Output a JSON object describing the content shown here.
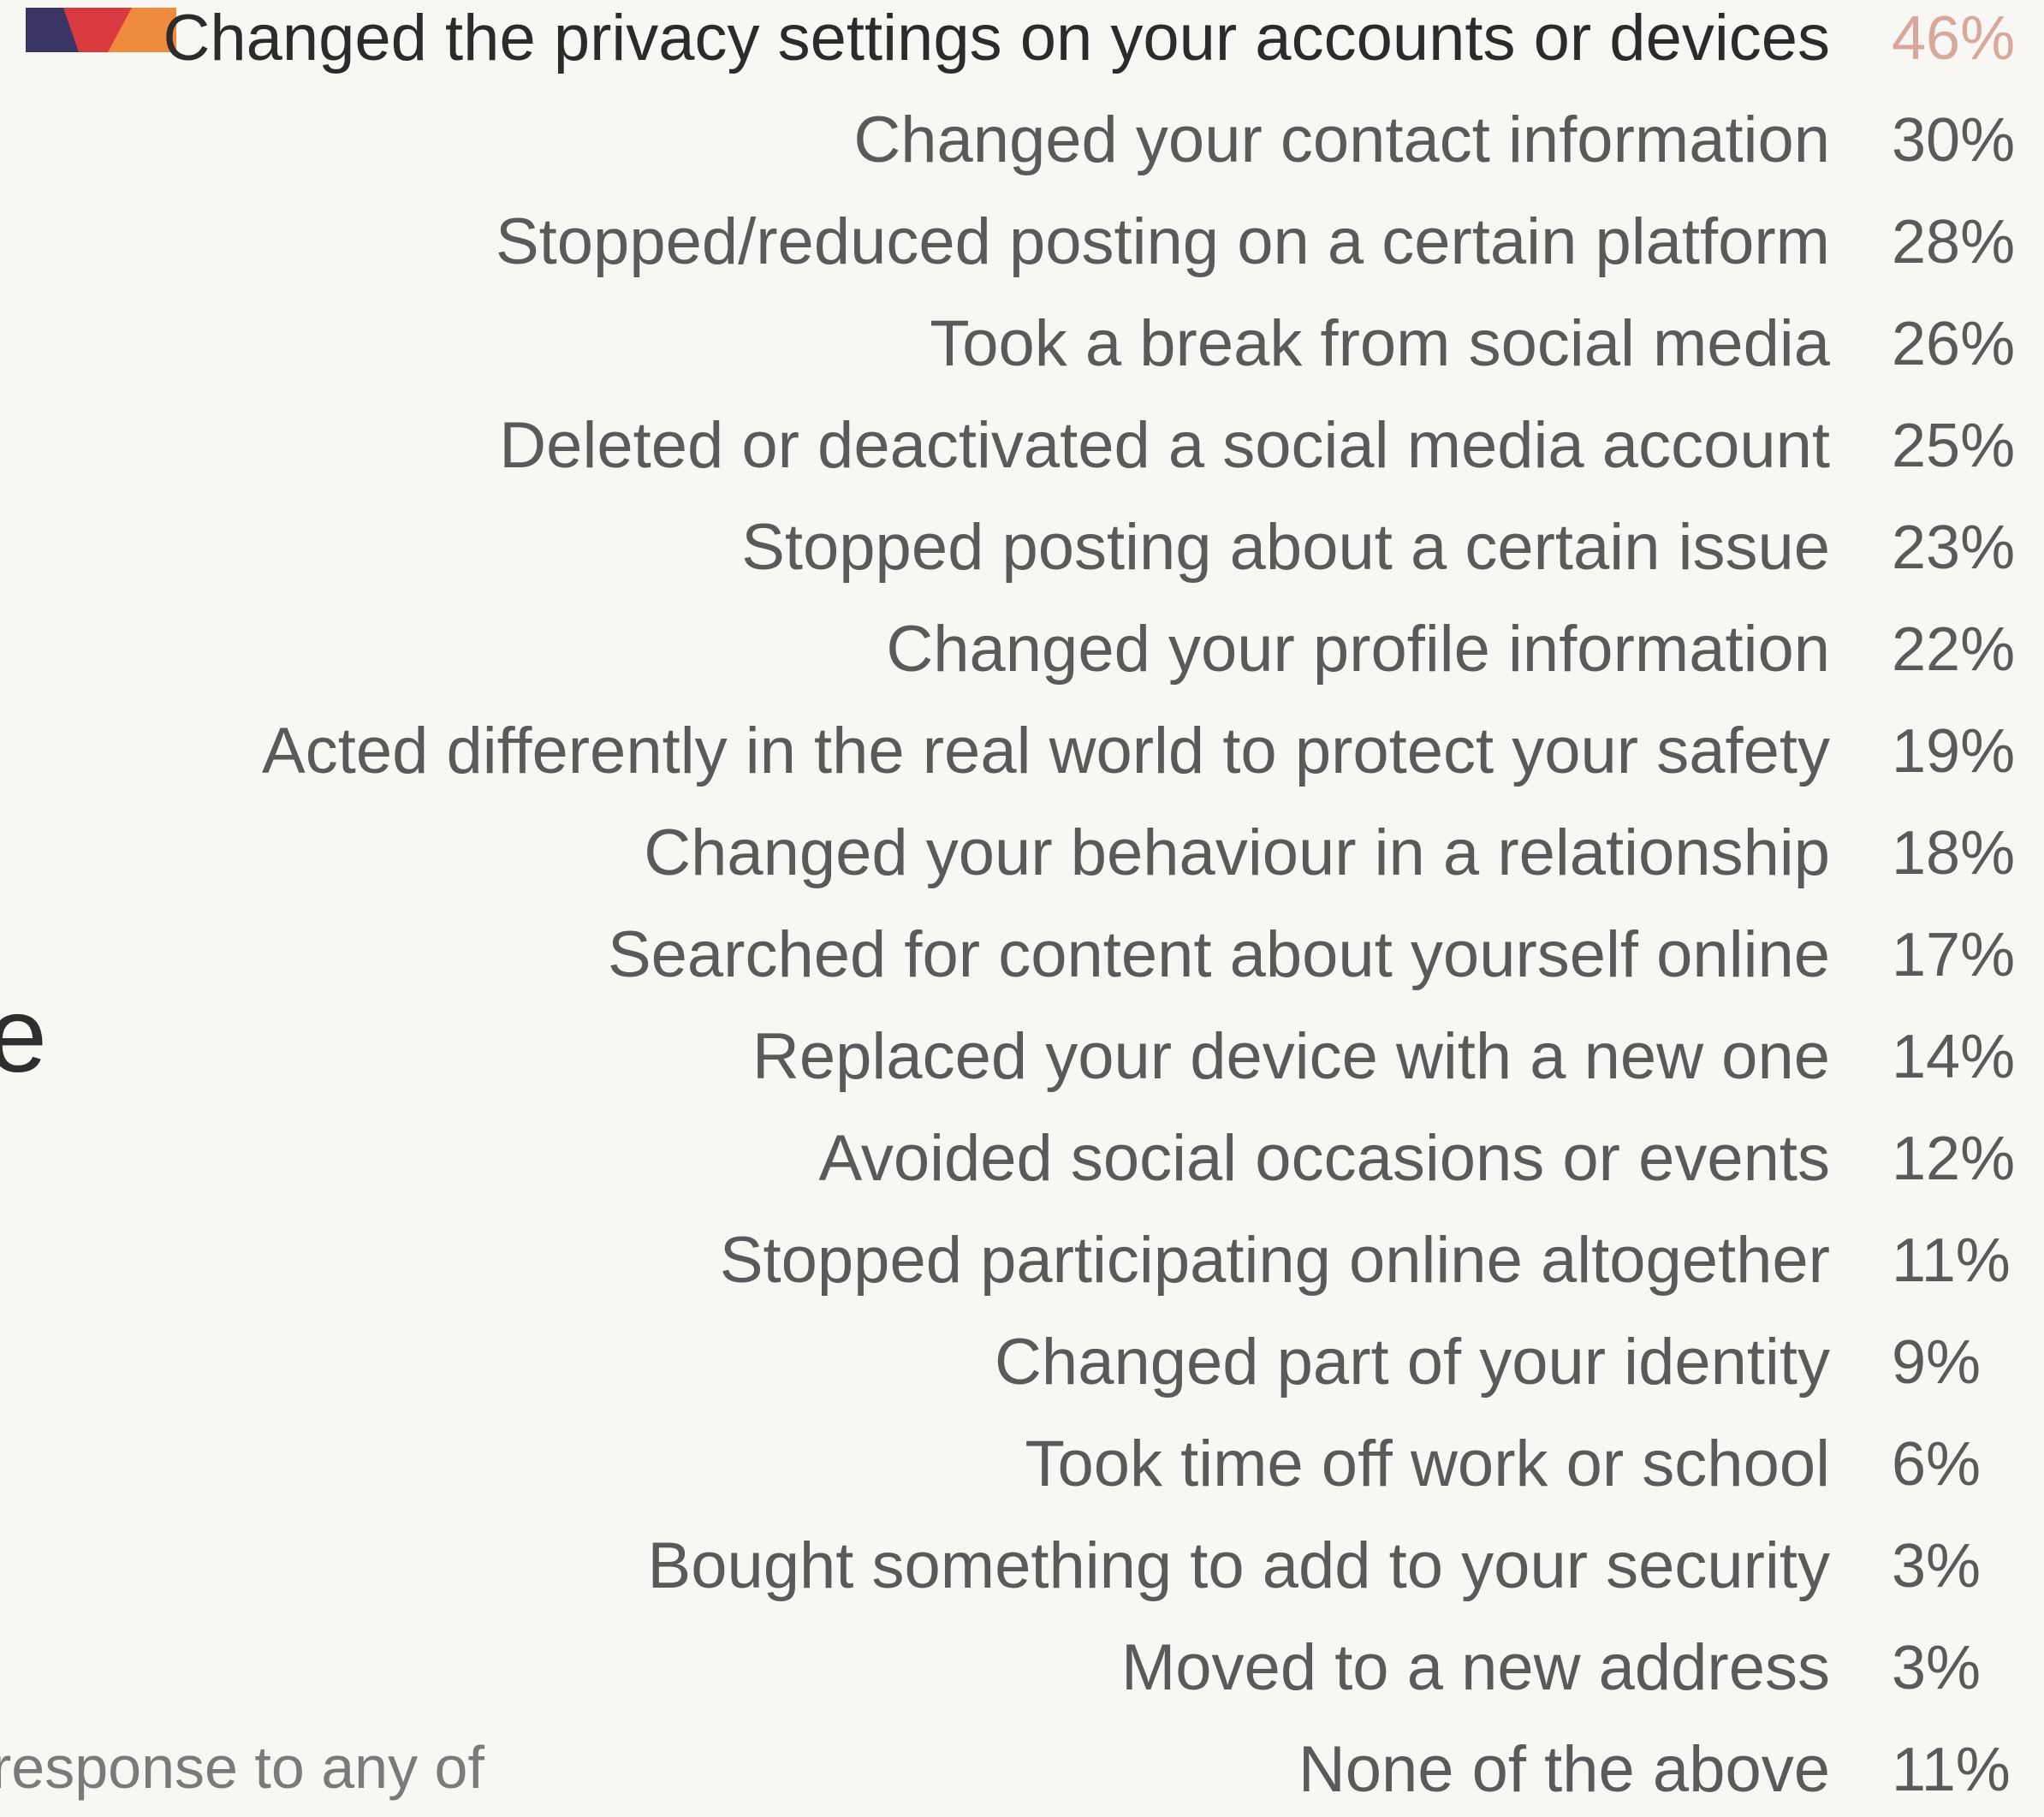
{
  "chart_data": {
    "type": "table",
    "highlight_index": 0,
    "highlight_label_color": "#2b2b2b",
    "highlight_value_color": "#d9a79c",
    "text_color": "#5a5a5a",
    "background_color": "#f8f7f3",
    "swatch_colors": [
      "#3b3566",
      "#d93a3f",
      "#f08a3c"
    ],
    "categories": [
      "Changed the privacy settings on your accounts or devices",
      "Changed your contact information",
      "Stopped/reduced posting on a certain platform",
      "Took a break from social media",
      "Deleted or deactivated a social media account",
      "Stopped posting about a certain issue",
      "Changed your profile information",
      "Acted differently in the real world to protect your safety",
      "Changed your behaviour in a relationship",
      "Searched for content about yourself online",
      "Replaced your device with a new one",
      "Avoided social occasions or events",
      "Stopped participating online altogether",
      "Changed part of your identity",
      "Took time off work or school",
      "Bought something to add to your security",
      "Moved to a new address",
      "None of the above"
    ],
    "values": [
      46,
      30,
      28,
      26,
      25,
      23,
      22,
      19,
      18,
      17,
      14,
      12,
      11,
      9,
      6,
      3,
      3,
      11
    ],
    "value_labels": [
      "46%",
      "30%",
      "28%",
      "26%",
      "25%",
      "23%",
      "22%",
      "19%",
      "18%",
      "17%",
      "14%",
      "12%",
      "11%",
      "9%",
      "6%",
      "3%",
      "3%",
      "11%"
    ]
  },
  "side": {
    "glyph": "e",
    "caption": "response to any of"
  }
}
